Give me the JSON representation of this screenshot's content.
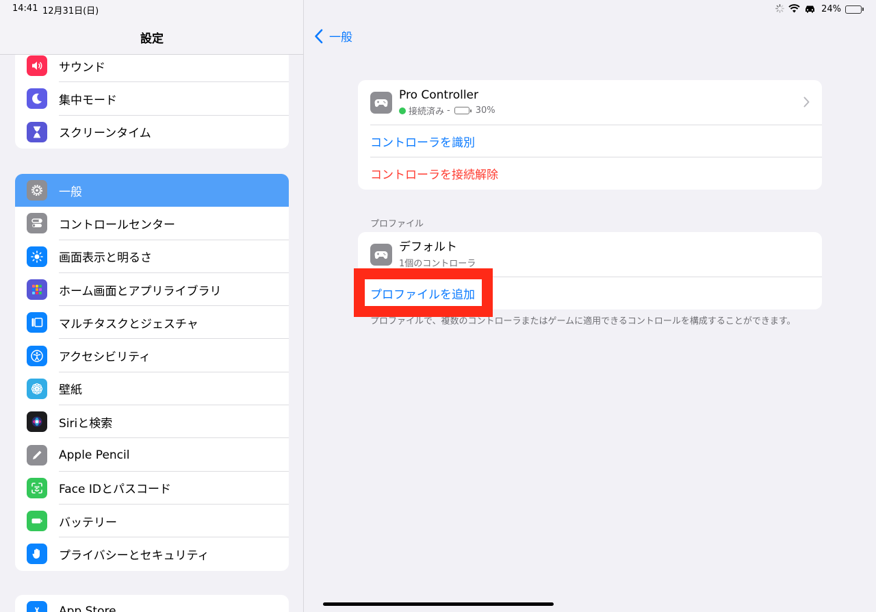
{
  "status_bar": {
    "time": "14:41",
    "date": "12月31日(日)",
    "battery_pct": "24%",
    "battery_level": 0.24
  },
  "sidebar": {
    "title": "設定",
    "group1": [
      {
        "label": "サウンド",
        "icon": "speaker-icon",
        "color": "#ff2d55"
      },
      {
        "label": "集中モード",
        "icon": "moon-icon",
        "color": "#5e5ce6"
      },
      {
        "label": "スクリーンタイム",
        "icon": "hourglass-icon",
        "color": "#5856d6"
      }
    ],
    "group2": [
      {
        "label": "一般",
        "icon": "gear-icon",
        "color": "#8e8e93",
        "selected": true
      },
      {
        "label": "コントロールセンター",
        "icon": "toggles-icon",
        "color": "#8e8e93"
      },
      {
        "label": "画面表示と明るさ",
        "icon": "sun-icon",
        "color": "#0a84ff"
      },
      {
        "label": "ホーム画面とアプリライブラリ",
        "icon": "app-grid-icon",
        "color": "#5856d6"
      },
      {
        "label": "マルチタスクとジェスチャ",
        "icon": "multitask-icon",
        "color": "#0a84ff"
      },
      {
        "label": "アクセシビリティ",
        "icon": "accessibility-icon",
        "color": "#0a84ff"
      },
      {
        "label": "壁紙",
        "icon": "flower-icon",
        "color": "#32ade6"
      },
      {
        "label": "Siriと検索",
        "icon": "siri-icon",
        "color": "#1c1c1e"
      },
      {
        "label": "Apple Pencil",
        "icon": "pencil-icon",
        "color": "#8e8e93"
      },
      {
        "label": "Face IDとパスコード",
        "icon": "faceid-icon",
        "color": "#34c759"
      },
      {
        "label": "バッテリー",
        "icon": "battery-icon",
        "color": "#34c759"
      },
      {
        "label": "プライバシーとセキュリティ",
        "icon": "hand-icon",
        "color": "#0a84ff"
      }
    ],
    "group3": [
      {
        "label": "App Store",
        "icon": "app-store-icon",
        "color": "#0a84ff"
      }
    ]
  },
  "main": {
    "back_label": "一般",
    "controller": {
      "name": "Pro Controller",
      "status": "接続済み",
      "separator": "-",
      "battery": "30%",
      "battery_level": 0.3
    },
    "identify_label": "コントローラを識別",
    "disconnect_label": "コントローラを接続解除",
    "profiles_header": "プロファイル",
    "profile_name": "デフォルト",
    "profile_sub": "1個のコントローラ",
    "add_profile_label": "プロファイルを追加",
    "footer_note": "プロファイルで、複数のコントローラまたはゲームに適用できるコントロールを構成することができます。"
  },
  "colors": {
    "accent": "#0a7aff",
    "destructive": "#ff3b30",
    "selected_row": "#52a0f9",
    "highlight": "#ff2a17"
  }
}
